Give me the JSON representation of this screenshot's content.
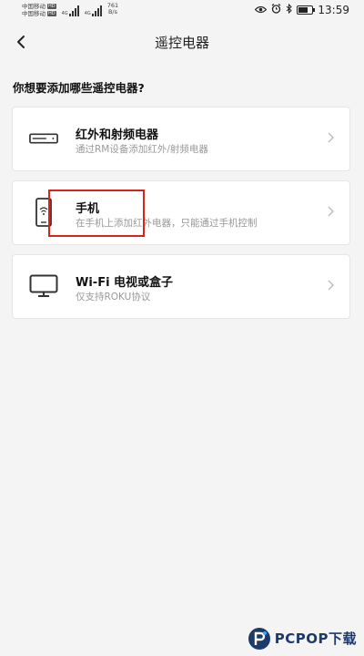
{
  "status_bar": {
    "carrier_1": "中国移动",
    "carrier_2": "中国移动",
    "hd_label": "HD",
    "net_type_1": "4G",
    "net_type_2": "4G",
    "net_speed_value": "761",
    "net_speed_unit": "B/s",
    "battery_level": 0.7,
    "time": "13:59"
  },
  "header": {
    "title": "遥控电器"
  },
  "prompt": "你想要添加哪些遥控电器?",
  "options": [
    {
      "title": "红外和射频电器",
      "subtitle": "通过RM设备添加红外/射频电器",
      "icon": "rm-device-icon"
    },
    {
      "title": "手机",
      "subtitle": "在手机上添加红外电器，只能通过手机控制",
      "icon": "phone-icon"
    },
    {
      "title": "Wi-Fi 电视或盒子",
      "subtitle": "仅支持ROKU协议",
      "icon": "tv-icon"
    }
  ],
  "colors": {
    "highlight": "#d9241c",
    "background": "#f4f4f4",
    "card": "#ffffff",
    "subtitle": "#999999"
  },
  "watermark": {
    "brand": "PCPOP下载"
  }
}
